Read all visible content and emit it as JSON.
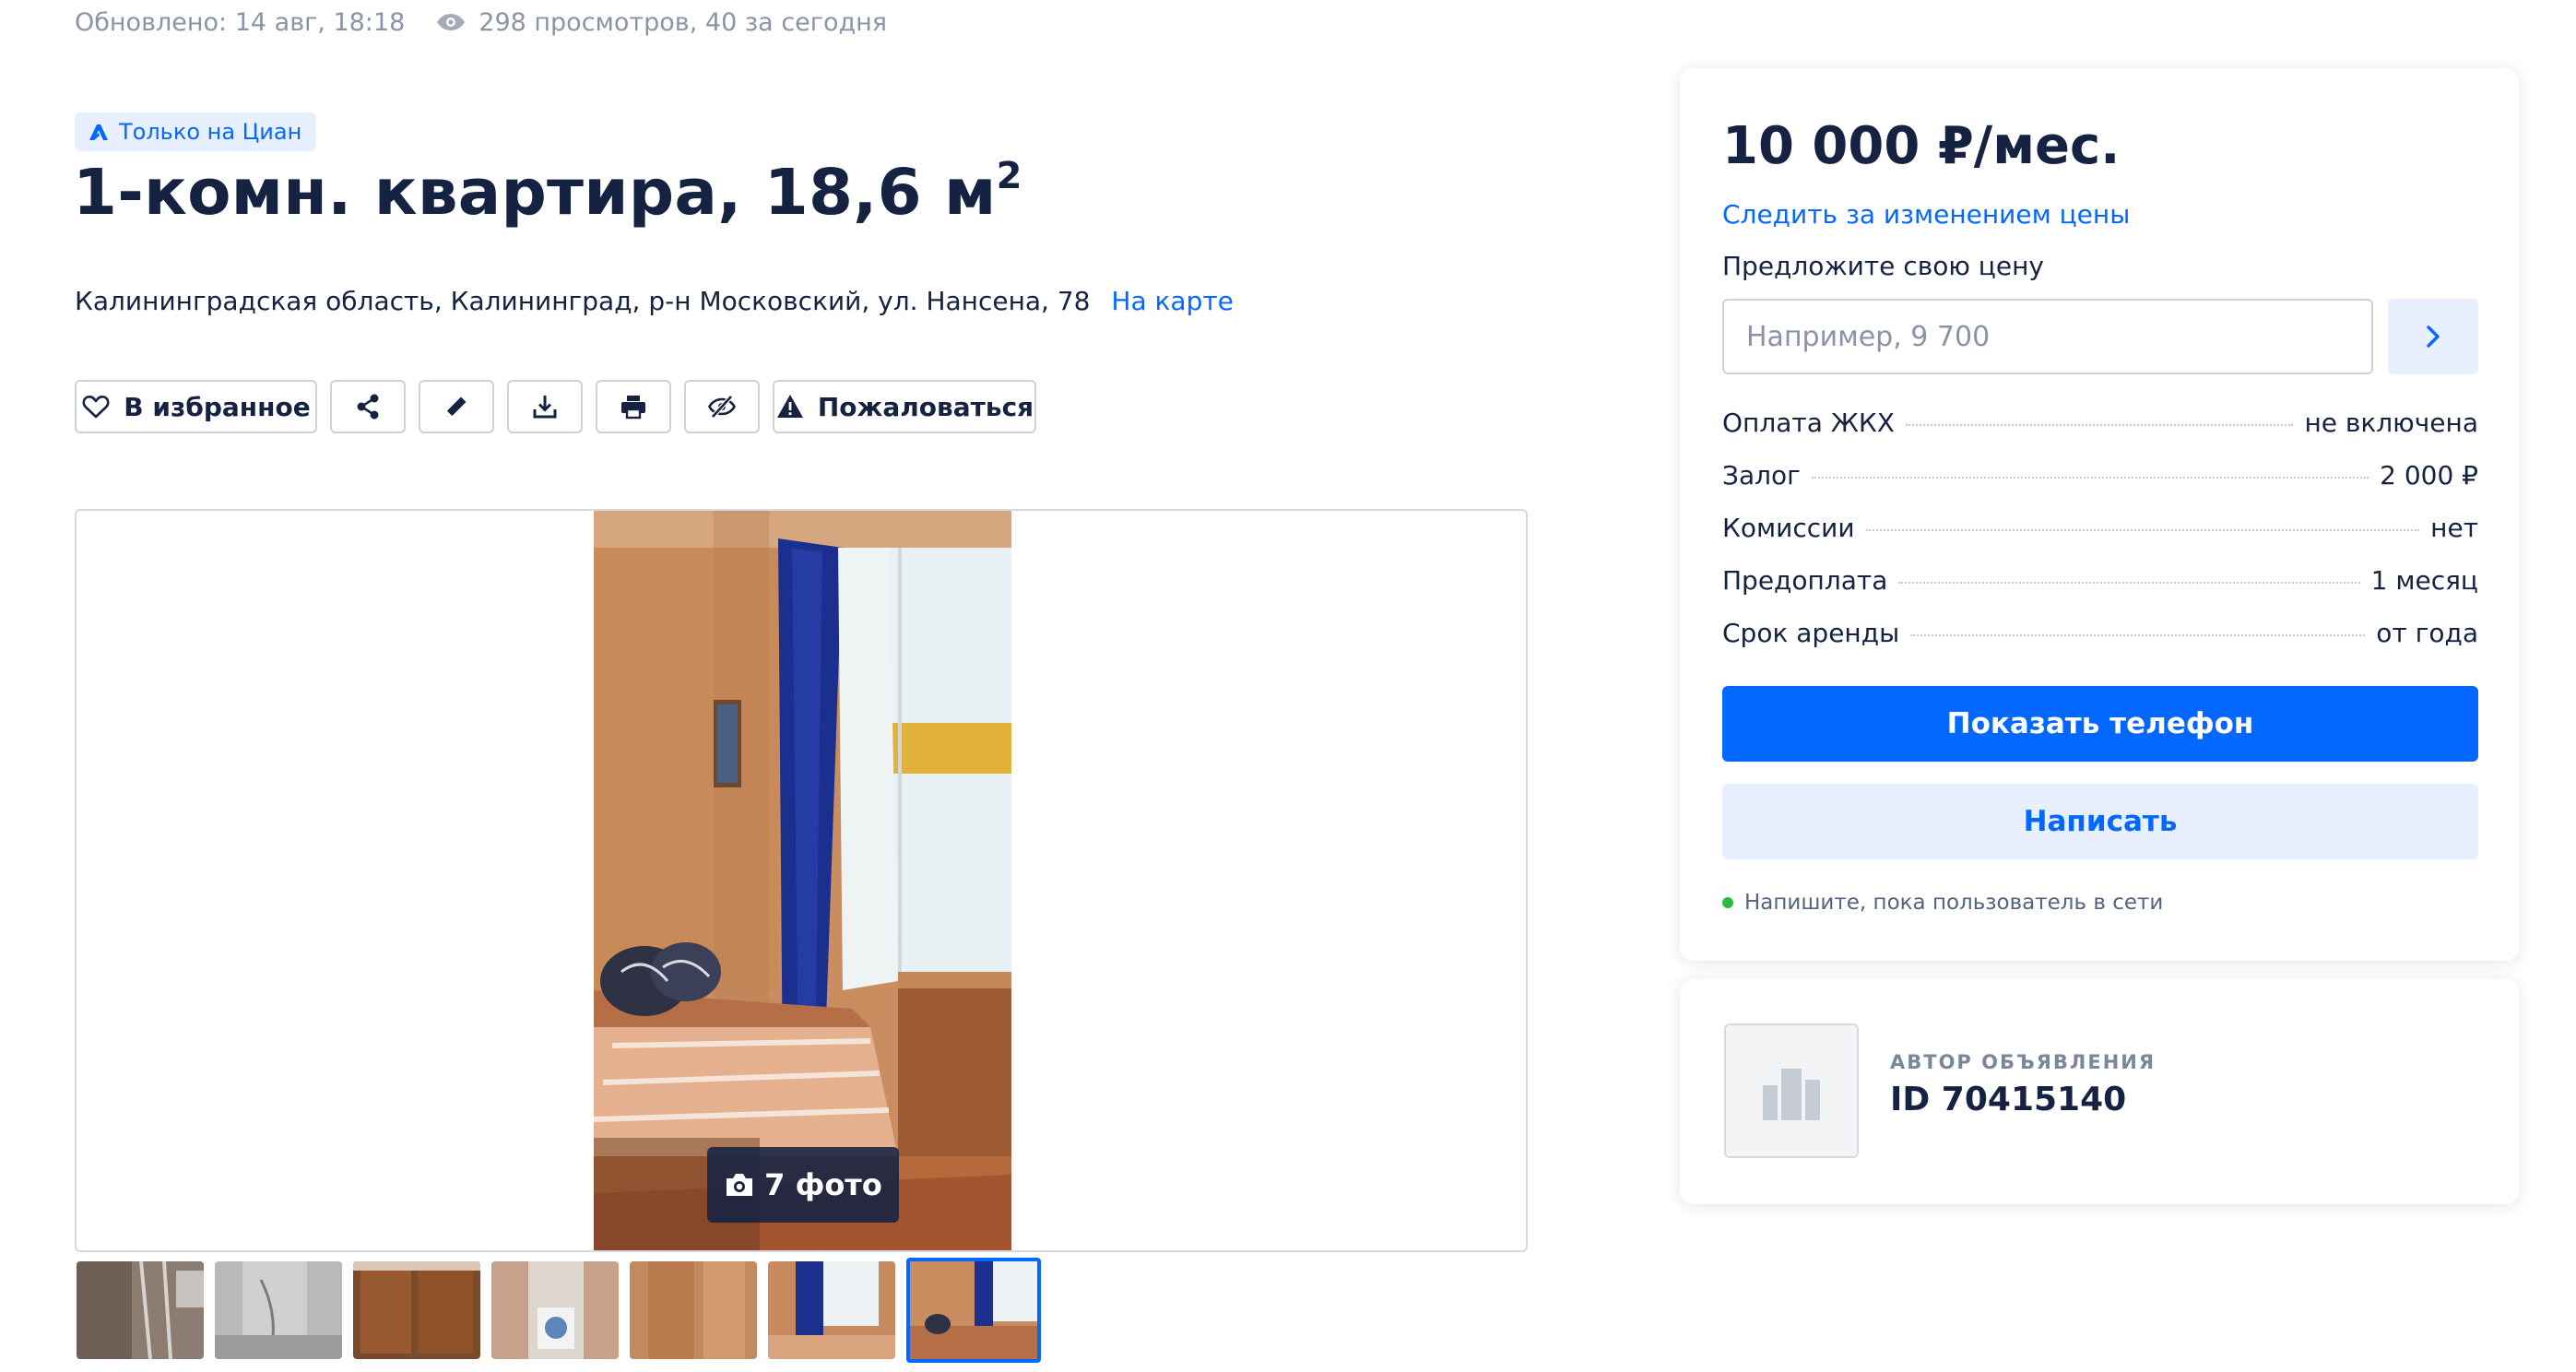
{
  "meta": {
    "updated": "Обновлено: 14 авг, 18:18",
    "views": "298 просмотров, 40 за сегодня",
    "views_icon": "eye-icon"
  },
  "badge": {
    "label": "Только на Циан",
    "icon": "cian-logo-icon"
  },
  "listing": {
    "title_main": "1-комн. квартира, 18,6 м",
    "title_sup": "2",
    "address": "Калининградская область, Калининград, р-н Московский, ул. Нансена, 78",
    "map_link": "На карте"
  },
  "actions": {
    "favorite_label": "В избранное",
    "report_label": "Пожаловаться",
    "icons": [
      "heart-icon",
      "share-icon",
      "pencil-icon",
      "download-icon",
      "print-icon",
      "hide-icon",
      "warning-icon"
    ]
  },
  "gallery": {
    "photo_count_label": "7 фото",
    "thumbnail_count": 7,
    "active_thumbnail": 7
  },
  "price_card": {
    "price": "10 000 ₽/мес.",
    "watch_price": "Следить за изменением цены",
    "offer_label": "Предложите свою цену",
    "offer_placeholder": "Например, 9 700",
    "offer_value": "",
    "terms": [
      {
        "label": "Оплата ЖКХ",
        "value": "не включена"
      },
      {
        "label": "Залог",
        "value": "2 000 ₽"
      },
      {
        "label": "Комиссии",
        "value": "нет"
      },
      {
        "label": "Предоплата",
        "value": "1 месяц"
      },
      {
        "label": "Срок аренды",
        "value": "от года"
      }
    ],
    "phone_button": "Показать телефон",
    "write_button": "Написать",
    "online_note": "Напишите, пока пользователь в сети"
  },
  "author": {
    "caption": "АВТОР ОБЪЯВЛЕНИЯ",
    "id": "ID 70415140"
  },
  "colors": {
    "accent": "#0468ff",
    "accent_light": "#e8effe",
    "text": "#152242",
    "muted": "#8a94a6",
    "online": "#2cbb3f"
  }
}
